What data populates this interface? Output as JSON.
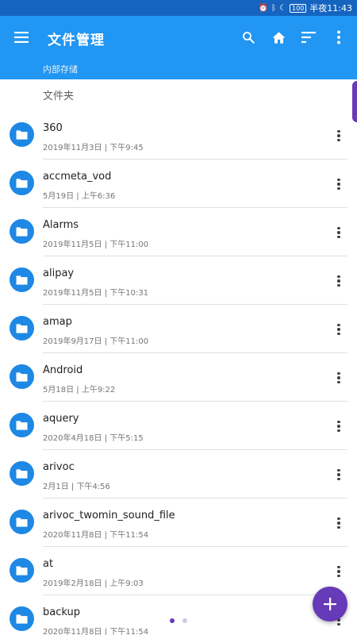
{
  "status_bar": {
    "time": "半夜11:43",
    "battery": "100"
  },
  "app_bar": {
    "title": "文件管理",
    "breadcrumb": "内部存储",
    "color": "#2196f3",
    "icons": [
      "menu-icon",
      "search-icon",
      "home-icon",
      "sort-icon",
      "more-vert-icon"
    ]
  },
  "section_header": "文件夹",
  "files": [
    {
      "name": "360",
      "meta": "2019年11月3日 | 下午9:45"
    },
    {
      "name": "accmeta_vod",
      "meta": "5月19日 | 上午6:36"
    },
    {
      "name": "Alarms",
      "meta": "2019年11月5日 | 下午11:00"
    },
    {
      "name": "alipay",
      "meta": "2019年11月5日 | 下午10:31"
    },
    {
      "name": "amap",
      "meta": "2019年9月17日 | 下午11:00"
    },
    {
      "name": "Android",
      "meta": "5月18日 | 上午9:22"
    },
    {
      "name": "aquery",
      "meta": "2020年4月18日 | 下午5:15"
    },
    {
      "name": "arivoc",
      "meta": "2月1日 | 下午4:56"
    },
    {
      "name": "arivoc_twomin_sound_file",
      "meta": "2020年11月8日 | 下午11:54"
    },
    {
      "name": "at",
      "meta": "2019年2月18日 | 上午9:03"
    },
    {
      "name": "backup",
      "meta": "2020年11月8日 | 下午11:54"
    }
  ],
  "fab": {
    "icon": "plus-icon",
    "color": "#673ab7"
  },
  "page_indicator": {
    "current": 1,
    "total": 2
  }
}
